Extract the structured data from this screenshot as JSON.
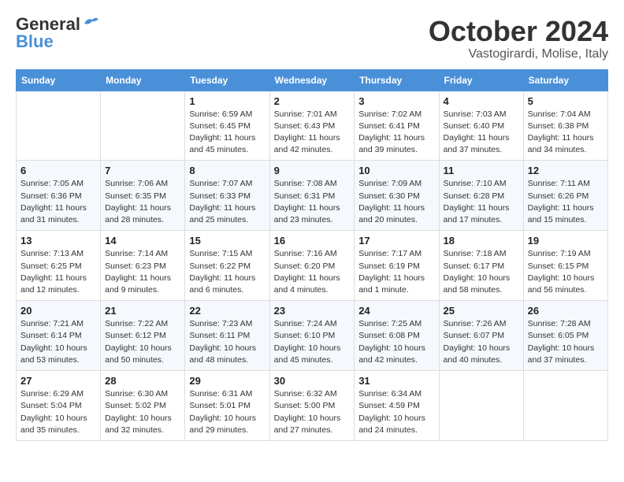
{
  "header": {
    "logo_general": "General",
    "logo_blue": "Blue",
    "month_title": "October 2024",
    "subtitle": "Vastogirardi, Molise, Italy"
  },
  "days_of_week": [
    "Sunday",
    "Monday",
    "Tuesday",
    "Wednesday",
    "Thursday",
    "Friday",
    "Saturday"
  ],
  "weeks": [
    [
      {
        "day": "",
        "info": ""
      },
      {
        "day": "",
        "info": ""
      },
      {
        "day": "1",
        "info": "Sunrise: 6:59 AM\nSunset: 6:45 PM\nDaylight: 11 hours and 45 minutes."
      },
      {
        "day": "2",
        "info": "Sunrise: 7:01 AM\nSunset: 6:43 PM\nDaylight: 11 hours and 42 minutes."
      },
      {
        "day": "3",
        "info": "Sunrise: 7:02 AM\nSunset: 6:41 PM\nDaylight: 11 hours and 39 minutes."
      },
      {
        "day": "4",
        "info": "Sunrise: 7:03 AM\nSunset: 6:40 PM\nDaylight: 11 hours and 37 minutes."
      },
      {
        "day": "5",
        "info": "Sunrise: 7:04 AM\nSunset: 6:38 PM\nDaylight: 11 hours and 34 minutes."
      }
    ],
    [
      {
        "day": "6",
        "info": "Sunrise: 7:05 AM\nSunset: 6:36 PM\nDaylight: 11 hours and 31 minutes."
      },
      {
        "day": "7",
        "info": "Sunrise: 7:06 AM\nSunset: 6:35 PM\nDaylight: 11 hours and 28 minutes."
      },
      {
        "day": "8",
        "info": "Sunrise: 7:07 AM\nSunset: 6:33 PM\nDaylight: 11 hours and 25 minutes."
      },
      {
        "day": "9",
        "info": "Sunrise: 7:08 AM\nSunset: 6:31 PM\nDaylight: 11 hours and 23 minutes."
      },
      {
        "day": "10",
        "info": "Sunrise: 7:09 AM\nSunset: 6:30 PM\nDaylight: 11 hours and 20 minutes."
      },
      {
        "day": "11",
        "info": "Sunrise: 7:10 AM\nSunset: 6:28 PM\nDaylight: 11 hours and 17 minutes."
      },
      {
        "day": "12",
        "info": "Sunrise: 7:11 AM\nSunset: 6:26 PM\nDaylight: 11 hours and 15 minutes."
      }
    ],
    [
      {
        "day": "13",
        "info": "Sunrise: 7:13 AM\nSunset: 6:25 PM\nDaylight: 11 hours and 12 minutes."
      },
      {
        "day": "14",
        "info": "Sunrise: 7:14 AM\nSunset: 6:23 PM\nDaylight: 11 hours and 9 minutes."
      },
      {
        "day": "15",
        "info": "Sunrise: 7:15 AM\nSunset: 6:22 PM\nDaylight: 11 hours and 6 minutes."
      },
      {
        "day": "16",
        "info": "Sunrise: 7:16 AM\nSunset: 6:20 PM\nDaylight: 11 hours and 4 minutes."
      },
      {
        "day": "17",
        "info": "Sunrise: 7:17 AM\nSunset: 6:19 PM\nDaylight: 11 hours and 1 minute."
      },
      {
        "day": "18",
        "info": "Sunrise: 7:18 AM\nSunset: 6:17 PM\nDaylight: 10 hours and 58 minutes."
      },
      {
        "day": "19",
        "info": "Sunrise: 7:19 AM\nSunset: 6:15 PM\nDaylight: 10 hours and 56 minutes."
      }
    ],
    [
      {
        "day": "20",
        "info": "Sunrise: 7:21 AM\nSunset: 6:14 PM\nDaylight: 10 hours and 53 minutes."
      },
      {
        "day": "21",
        "info": "Sunrise: 7:22 AM\nSunset: 6:12 PM\nDaylight: 10 hours and 50 minutes."
      },
      {
        "day": "22",
        "info": "Sunrise: 7:23 AM\nSunset: 6:11 PM\nDaylight: 10 hours and 48 minutes."
      },
      {
        "day": "23",
        "info": "Sunrise: 7:24 AM\nSunset: 6:10 PM\nDaylight: 10 hours and 45 minutes."
      },
      {
        "day": "24",
        "info": "Sunrise: 7:25 AM\nSunset: 6:08 PM\nDaylight: 10 hours and 42 minutes."
      },
      {
        "day": "25",
        "info": "Sunrise: 7:26 AM\nSunset: 6:07 PM\nDaylight: 10 hours and 40 minutes."
      },
      {
        "day": "26",
        "info": "Sunrise: 7:28 AM\nSunset: 6:05 PM\nDaylight: 10 hours and 37 minutes."
      }
    ],
    [
      {
        "day": "27",
        "info": "Sunrise: 6:29 AM\nSunset: 5:04 PM\nDaylight: 10 hours and 35 minutes."
      },
      {
        "day": "28",
        "info": "Sunrise: 6:30 AM\nSunset: 5:02 PM\nDaylight: 10 hours and 32 minutes."
      },
      {
        "day": "29",
        "info": "Sunrise: 6:31 AM\nSunset: 5:01 PM\nDaylight: 10 hours and 29 minutes."
      },
      {
        "day": "30",
        "info": "Sunrise: 6:32 AM\nSunset: 5:00 PM\nDaylight: 10 hours and 27 minutes."
      },
      {
        "day": "31",
        "info": "Sunrise: 6:34 AM\nSunset: 4:59 PM\nDaylight: 10 hours and 24 minutes."
      },
      {
        "day": "",
        "info": ""
      },
      {
        "day": "",
        "info": ""
      }
    ]
  ]
}
